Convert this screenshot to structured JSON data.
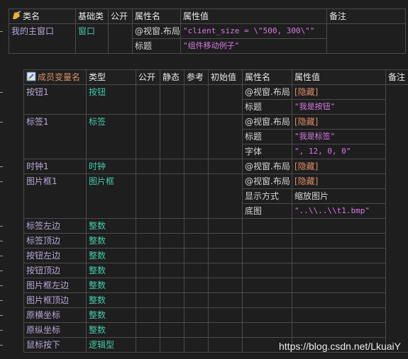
{
  "class_table": {
    "headers": [
      "类名",
      "基础类",
      "公开",
      "属性名",
      "属性值",
      "备注"
    ],
    "name": "我的主窗口",
    "base": "窗口",
    "props": [
      {
        "name": "@视窗.布局",
        "value": "\"client_size = \\\"500, 300\\\"\""
      },
      {
        "name": "标题",
        "value": "\"组件移动例子\""
      }
    ]
  },
  "member_table": {
    "headers": [
      "成员变量名",
      "类型",
      "公开",
      "静态",
      "参考",
      "初始值",
      "属性名",
      "属性值",
      "备注"
    ],
    "members": [
      {
        "name": "按钮1",
        "type": "按钮",
        "props": [
          {
            "name": "@视窗.布局",
            "value": "[隐藏]",
            "kind": "hidden"
          },
          {
            "name": "标题",
            "value": "\"我是按钮\"",
            "kind": "str"
          }
        ]
      },
      {
        "name": "标签1",
        "type": "标签",
        "props": [
          {
            "name": "@视窗.布局",
            "value": "[隐藏]",
            "kind": "hidden"
          },
          {
            "name": "标题",
            "value": "\"我是标签\"",
            "kind": "str"
          },
          {
            "name": "字体",
            "value": "\", 12, 0, 0\"",
            "kind": "str"
          }
        ]
      },
      {
        "name": "时钟1",
        "type": "时钟",
        "props": [
          {
            "name": "@视窗.布局",
            "value": "[隐藏]",
            "kind": "hidden"
          }
        ]
      },
      {
        "name": "图片框1",
        "type": "图片框",
        "props": [
          {
            "name": "@视窗.布局",
            "value": "[隐藏]",
            "kind": "hidden"
          },
          {
            "name": "显示方式",
            "value": "缩放图片",
            "kind": "plain"
          },
          {
            "name": "底图",
            "value": "\"..\\\\..\\\\t1.bmp\"",
            "kind": "str"
          }
        ]
      },
      {
        "name": "标签左边",
        "type": "整数",
        "props": []
      },
      {
        "name": "标签顶边",
        "type": "整数",
        "props": []
      },
      {
        "name": "按钮左边",
        "type": "整数",
        "props": []
      },
      {
        "name": "按钮顶边",
        "type": "整数",
        "props": []
      },
      {
        "name": "图片框左边",
        "type": "整数",
        "props": []
      },
      {
        "name": "图片框顶边",
        "type": "整数",
        "props": []
      },
      {
        "name": "原横坐标",
        "type": "整数",
        "props": []
      },
      {
        "name": "原纵坐标",
        "type": "整数",
        "props": []
      },
      {
        "name": "鼠标按下",
        "type": "逻辑型",
        "props": []
      }
    ]
  },
  "watermark": "https://blog.csdn.net/LkuaiY"
}
